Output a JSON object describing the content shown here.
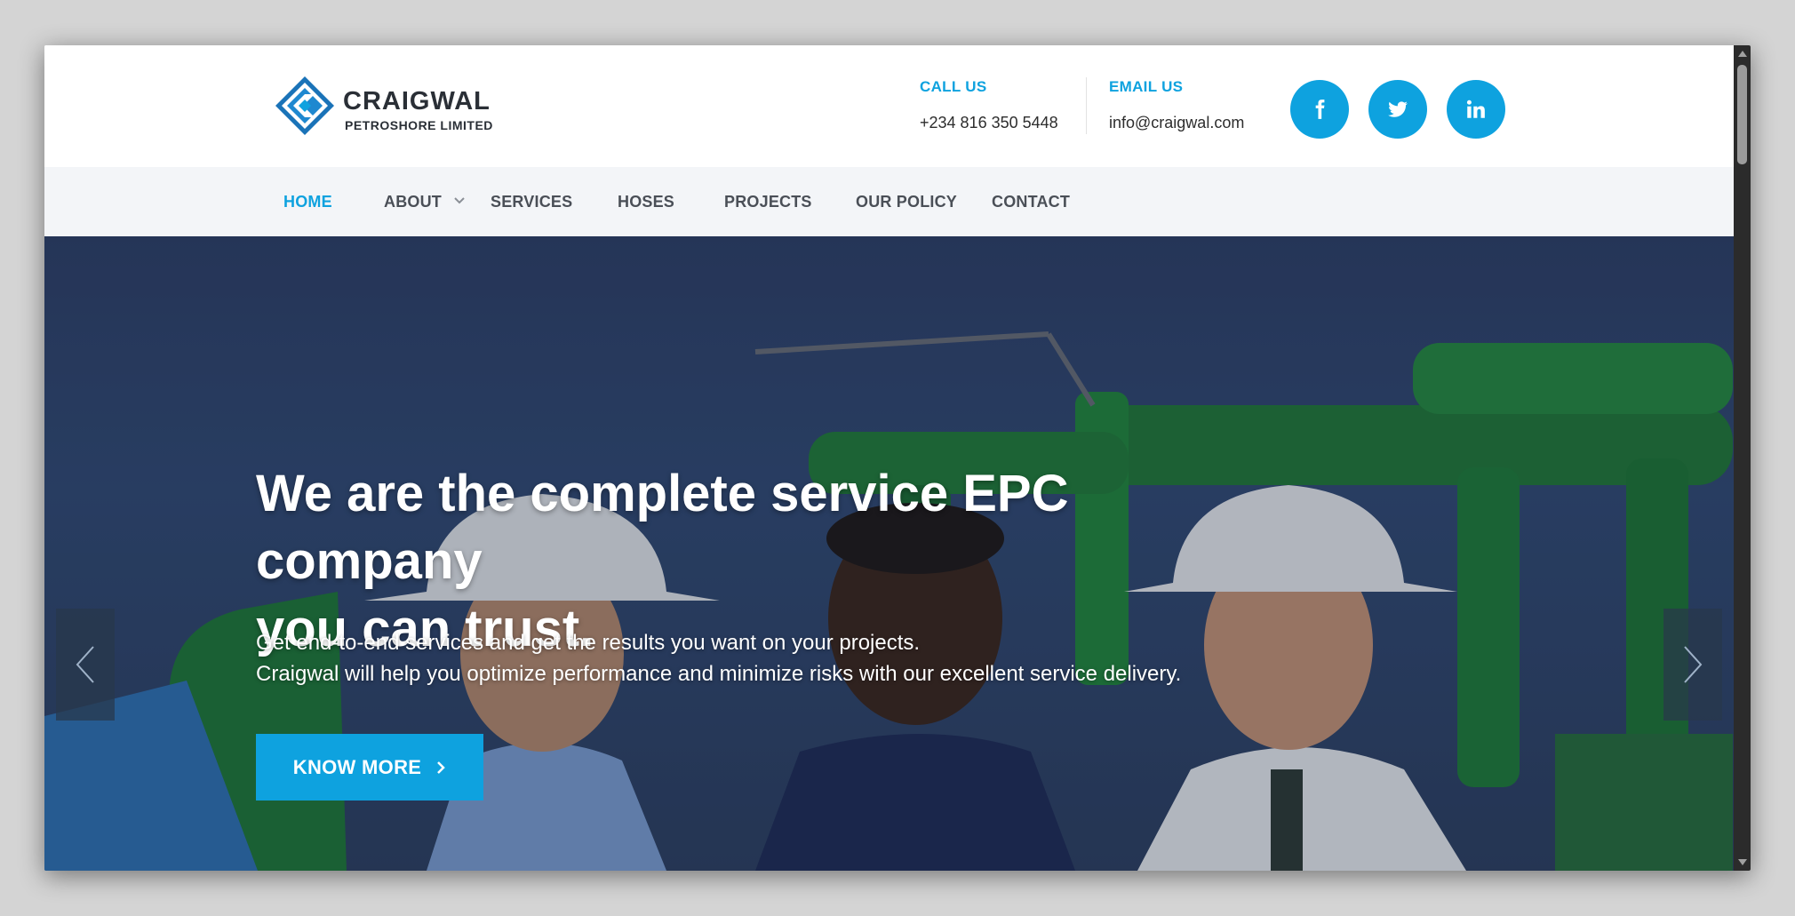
{
  "brand": {
    "name": "CRAIGWAL",
    "subtitle": "PETROSHORE LIMITED"
  },
  "contact": {
    "call_label": "CALL US",
    "call_value": "+234 816 350 5448",
    "email_label": "EMAIL US",
    "email_value": "info@craigwal.com"
  },
  "social": [
    "facebook-icon",
    "twitter-icon",
    "linkedin-icon"
  ],
  "nav": {
    "items": [
      {
        "label": "HOME",
        "active": true
      },
      {
        "label": "ABOUT",
        "has_dropdown": true
      },
      {
        "label": "SERVICES"
      },
      {
        "label": "HOSES"
      },
      {
        "label": "PROJECTS"
      },
      {
        "label": "OUR POLICY"
      },
      {
        "label": "CONTACT"
      }
    ]
  },
  "hero": {
    "title_line1": "We are the complete service EPC company",
    "title_line2": "you can trust.",
    "text_line1": "Get end-to-end services and get the results you want on your projects.",
    "text_line2": "Craigwal will help you optimize performance and minimize risks with our excellent service delivery.",
    "cta_label": "KNOW MORE"
  },
  "colors": {
    "accent": "#0ea2df",
    "nav_bg": "#f3f5f8",
    "text_dark": "#2a2f36"
  }
}
